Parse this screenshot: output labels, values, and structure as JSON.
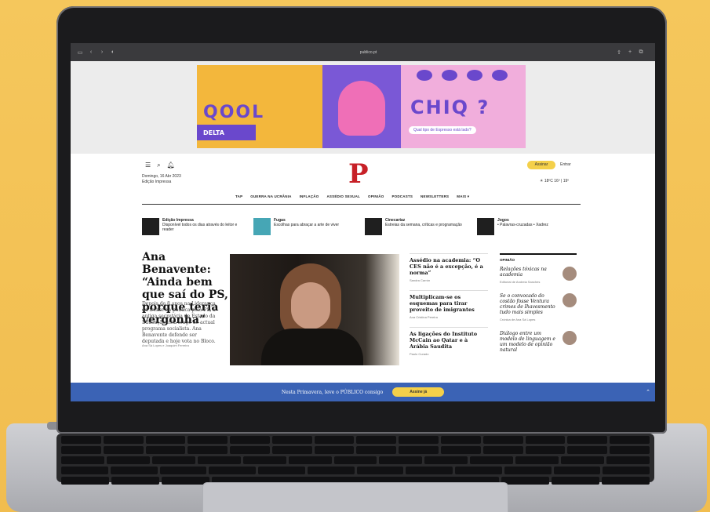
{
  "browser": {
    "url": "publico.pt"
  },
  "ad": {
    "left_text": "QOOL",
    "brand": "DELTA",
    "right_text": "CHIQ ?",
    "question": "Qual tipo de Expresso está lado?"
  },
  "header": {
    "date": "Domingo, 16 Abr 2023",
    "edition": "Edição Impressa",
    "logo": "P",
    "subscribe": "Assinar",
    "login": "Entrar",
    "weather": "☀ 18ºC 16º | 19º"
  },
  "nav": [
    "TAP",
    "GUERRA NA UCRÂNIA",
    "INFLAÇÃO",
    "ASSÉDIO SEXUAL",
    "OPINIÃO",
    "PODCASTS",
    "NEWSLETTERS",
    "MAIS ▾"
  ],
  "sections": [
    {
      "title": "Edição Impressa",
      "desc": "Disponível todos os dias através do leitor e reader",
      "color": "#1f1f1f"
    },
    {
      "title": "Fugas",
      "desc": "Escolhas para abraçar a arte de viver",
      "color": "#46a6b5"
    },
    {
      "title": "Cinecartaz",
      "desc": "Estreias da semana, críticas e programação",
      "color": "#1f1f1f"
    },
    {
      "title": "Jogos",
      "desc": "• Palavras-cruzadas • Xadrez",
      "color": "#1f1f1f"
    }
  ],
  "main": {
    "headline": "Ana Benavente: “Ainda bem que saí do PS, porque teria vergonha”",
    "lede": "Depois de 8 anos na Liderança da frente da política pelo PS, a antiga secretária de Estado da Educação está longe do actual programa socialista. Ana Benavente defende ser deputada e hoje vota no Bloco.",
    "authors": "Ana Sá Lopes e Joaquim Ferreira"
  },
  "right_list": [
    {
      "headline": "Assédio na academia: “O CES não é a excepção, é a norma”",
      "author": "Sandra Carrón"
    },
    {
      "headline": "Multiplicam-se os esquemas para tirar proveito de imigrantes",
      "author": "Ana Cristina Pereira"
    },
    {
      "headline": "As ligações do Instituto McCain ao Qatar e à Arábia Saudita",
      "author": "Paulo Curado"
    }
  ],
  "opinion": {
    "label": "OPINIÃO",
    "items": [
      {
        "headline": "Relações tóxicas na academia",
        "author": "Editorial de Andreia Sanches"
      },
      {
        "headline": "Se o convocado do costão fosse Ventura crimes de Ihavesmento tudo mais simples",
        "author": "Crónica de Ana Sá Lopes"
      },
      {
        "headline": "Diálogo entre um modelo de linguagem e um modelo de opinião natural",
        "author": ""
      }
    ]
  },
  "promo": {
    "text": "Nesta Primavera, leve o PÚBLICO consigo",
    "button": "Assine já",
    "chevron": "⌃"
  }
}
